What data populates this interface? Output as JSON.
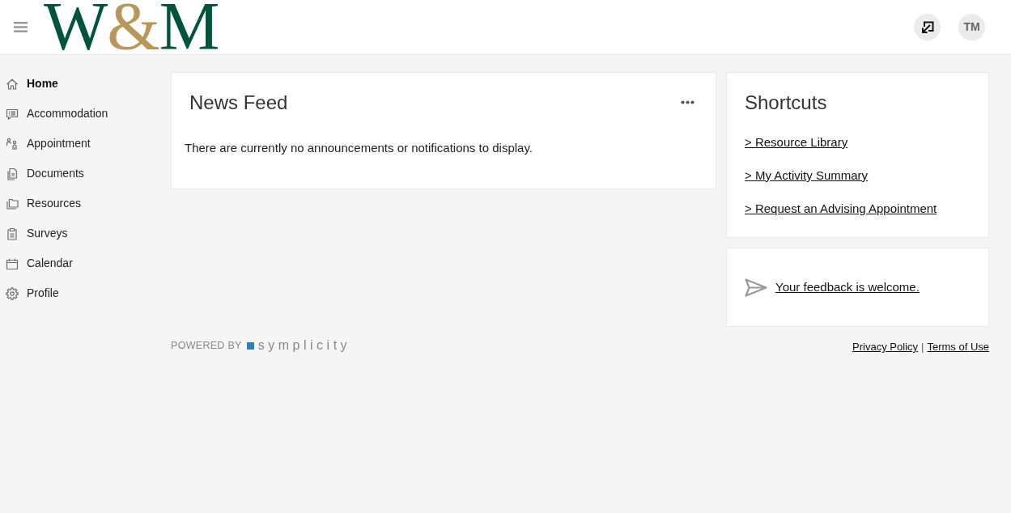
{
  "header": {
    "logo": {
      "parts": [
        {
          "text": "W",
          "color": "#00543c"
        },
        {
          "text": "&",
          "color": "#b9975b"
        },
        {
          "text": "M",
          "color": "#00543c"
        }
      ]
    },
    "avatar": {
      "initials": "TM"
    }
  },
  "sidebar": {
    "items": [
      {
        "label": "Home",
        "selected": true
      },
      {
        "label": "Accommodation",
        "selected": false
      },
      {
        "label": "Appointment",
        "selected": false
      },
      {
        "label": "Documents",
        "selected": false
      },
      {
        "label": "Resources",
        "selected": false
      },
      {
        "label": "Surveys",
        "selected": false
      },
      {
        "label": "Calendar",
        "selected": false
      },
      {
        "label": "Profile",
        "selected": false
      }
    ]
  },
  "news_feed": {
    "title": "News Feed",
    "message": "There are currently no announcements or notifications to display."
  },
  "shortcuts": {
    "title": "Shortcuts",
    "links": [
      "> Resource Library",
      "> My Activity Summary",
      "> Request an Advising Appointment"
    ]
  },
  "feedback": {
    "link": "Your feedback is welcome."
  },
  "footer": {
    "powered_by": "POWERED BY",
    "brand": "symplicity",
    "links": [
      "Privacy Policy",
      "Terms of Use"
    ],
    "separator": "|"
  }
}
